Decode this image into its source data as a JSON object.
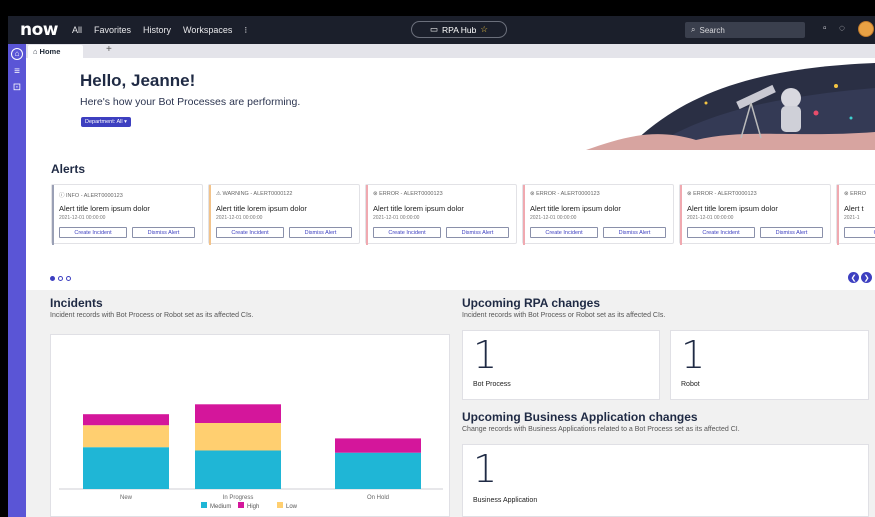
{
  "topnav": {
    "logo": "now",
    "links": [
      "All",
      "Favorites",
      "History",
      "Workspaces"
    ],
    "more": "⁝",
    "workspace_pill": "RPA Hub",
    "search_placeholder": "Search"
  },
  "tabs": {
    "home_label": "Home",
    "add_label": "+"
  },
  "hero": {
    "greeting": "Hello, Jeanne!",
    "subtitle": "Here's how your Bot Processes are performing.",
    "department_filter": "Department: All ▾"
  },
  "alerts": {
    "title": "Alerts",
    "cards": [
      {
        "header": "ⓘ INFO - ALERT0000123",
        "title": "Alert title lorem ipsum dolor",
        "date": "2021-12-01 00:00:00",
        "create": "Create Incident",
        "dismiss": "Dismiss Alert",
        "stripe": "#9aa0b5"
      },
      {
        "header": "⚠ WARNING - ALERT0000122",
        "title": "Alert title lorem ipsum dolor",
        "date": "2021-12-01 00:00:00",
        "create": "Create Incident",
        "dismiss": "Dismiss Alert",
        "stripe": "#f2c38b"
      },
      {
        "header": "⊗ ERROR - ALERT0000123",
        "title": "Alert title lorem ipsum dolor",
        "date": "2021-12-01 00:00:00",
        "create": "Create Incident",
        "dismiss": "Dismiss Alert",
        "stripe": "#f0a9b0"
      },
      {
        "header": "⊗ ERROR - ALERT0000123",
        "title": "Alert title lorem ipsum dolor",
        "date": "2021-12-01 00:00:00",
        "create": "Create Incident",
        "dismiss": "Dismiss Alert",
        "stripe": "#f0a9b0"
      },
      {
        "header": "⊗ ERROR - ALERT0000123",
        "title": "Alert title lorem ipsum dolor",
        "date": "2021-12-01 00:00:00",
        "create": "Create Incident",
        "dismiss": "Dismiss Alert",
        "stripe": "#f0a9b0"
      },
      {
        "header": "⊗ ERRO",
        "title": "Alert t",
        "date": "2021-1",
        "create": "Cre",
        "dismiss": "",
        "stripe": "#f0a9b0"
      }
    ]
  },
  "incidents": {
    "title": "Incidents",
    "subtitle": "Incident records with Bot Process or Robot set as its affected CIs."
  },
  "chart_data": {
    "type": "bar",
    "stacked": true,
    "categories": [
      "New",
      "In Progress",
      "On Hold"
    ],
    "series": [
      {
        "name": "Medium",
        "values": [
          38,
          35,
          33
        ],
        "color": "#1fb6d6"
      },
      {
        "name": "Low",
        "values": [
          20,
          25,
          0
        ],
        "color": "#ffcf70"
      },
      {
        "name": "High",
        "values": [
          10,
          17,
          13
        ],
        "color": "#d4169b"
      }
    ],
    "ylim": [
      0,
      100
    ],
    "legend_position": "bottom",
    "legend": [
      "Medium",
      "High",
      "Low"
    ]
  },
  "upcoming_rpa": {
    "title": "Upcoming RPA changes",
    "subtitle": "Incident records with Bot Process or Robot set as its affected CIs.",
    "stats": [
      {
        "value": "1",
        "label": "Bot Process"
      },
      {
        "value": "1",
        "label": "Robot"
      }
    ]
  },
  "upcoming_business": {
    "title": "Upcoming Business Application changes",
    "subtitle": "Change records with Business Applications related to a Bot Process set as its affected CI.",
    "stats": [
      {
        "value": "1",
        "label": "Business Application"
      }
    ]
  }
}
